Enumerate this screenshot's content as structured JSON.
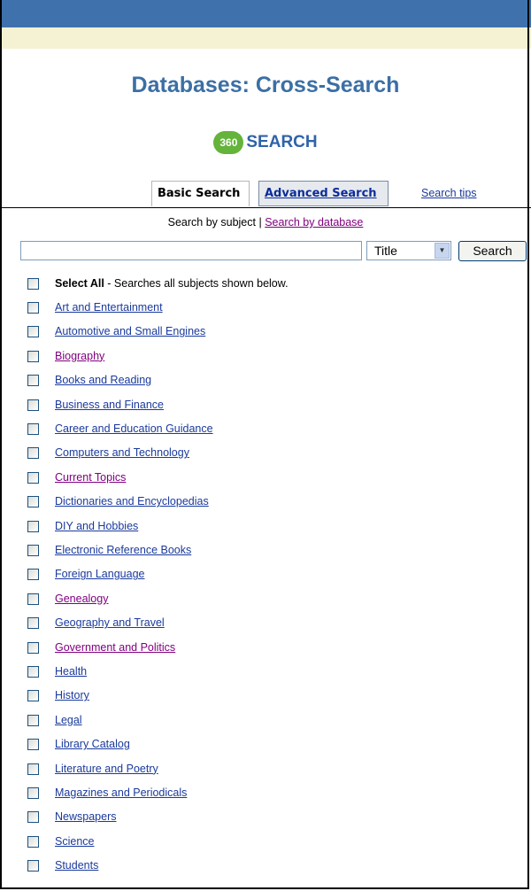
{
  "header": {
    "title": "Databases: Cross-Search",
    "logo_badge": "360",
    "logo_text": "SEARCH"
  },
  "tabs": {
    "basic": "Basic Search",
    "advanced": "Advanced Search",
    "tips": "Search tips"
  },
  "subnav": {
    "prefix": "Search by subject |",
    "link": "Search by database"
  },
  "search": {
    "query_value": "",
    "field_selected": "Title",
    "button_label": "Search"
  },
  "select_all": {
    "bold": "Select All",
    "rest": " - Searches all subjects shown below."
  },
  "subjects": [
    {
      "label": "Art and Entertainment",
      "visited": false
    },
    {
      "label": "Automotive and Small Engines",
      "visited": false
    },
    {
      "label": "Biography",
      "visited": true
    },
    {
      "label": "Books and Reading",
      "visited": false
    },
    {
      "label": "Business and Finance",
      "visited": false
    },
    {
      "label": "Career and Education Guidance",
      "visited": false
    },
    {
      "label": "Computers and Technology",
      "visited": false
    },
    {
      "label": "Current Topics",
      "visited": true
    },
    {
      "label": "Dictionaries and Encyclopedias",
      "visited": false
    },
    {
      "label": "DIY and Hobbies",
      "visited": false
    },
    {
      "label": "Electronic Reference Books",
      "visited": false
    },
    {
      "label": "Foreign Language",
      "visited": false
    },
    {
      "label": "Genealogy",
      "visited": true
    },
    {
      "label": "Geography and Travel",
      "visited": false
    },
    {
      "label": "Government and Politics",
      "visited": true
    },
    {
      "label": "Health",
      "visited": false
    },
    {
      "label": "History",
      "visited": false
    },
    {
      "label": "Legal",
      "visited": false
    },
    {
      "label": "Library Catalog",
      "visited": false
    },
    {
      "label": "Literature and Poetry",
      "visited": false
    },
    {
      "label": "Magazines and Periodicals",
      "visited": false
    },
    {
      "label": "Newspapers",
      "visited": false
    },
    {
      "label": "Science",
      "visited": false
    },
    {
      "label": "Students",
      "visited": false
    }
  ],
  "colors": {
    "topbar": "#3f72ad",
    "creambar": "#f4f2d2",
    "title": "#3b6fa5",
    "link": "#1a3a9c",
    "visited": "#800080",
    "logo_green": "#64b33b"
  },
  "icons": {
    "dropdown": "chevron-down-icon"
  }
}
